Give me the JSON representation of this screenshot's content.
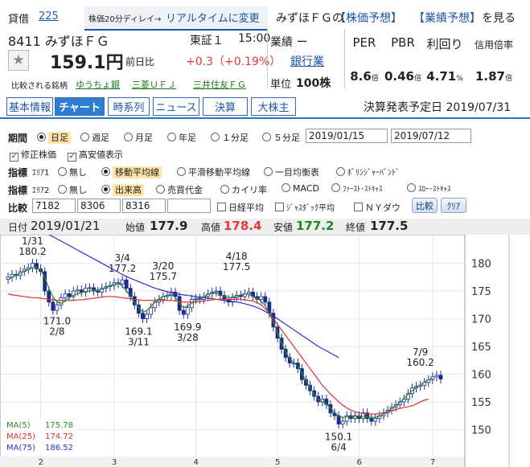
{
  "header": {
    "credit_label": "貸借",
    "market_code": "225",
    "delay_note": "株価20分ディレイ→",
    "realtime_link": "リアルタイムに変更",
    "company_q": "みずほＦＧの",
    "forecast_stock": "【株価予想】",
    "forecast_perf": "【業績予想】",
    "view_text": "を見る"
  },
  "stock": {
    "code_name": "8411 みずほＦＧ",
    "exchange": "東証１",
    "time": "15:00",
    "price": "159.1円",
    "prev_label": "前日比",
    "change": "+0.3（+0.19%）",
    "star": "★",
    "industry_label": "業績 ー",
    "industry_value": "銀行業",
    "unit_label": "単位",
    "unit_value": "100株"
  },
  "metrics": [
    {
      "label": "PER",
      "value": "8.6",
      "unit": "倍"
    },
    {
      "label": "PBR",
      "value": "0.46",
      "unit": "倍"
    },
    {
      "label": "利回り",
      "value": "4.71",
      "unit": "%"
    },
    {
      "label": "信用倍率",
      "value": "1.87",
      "unit": "倍"
    }
  ],
  "compare": {
    "label": "比較される銘柄",
    "items": [
      "ゆうちょ銀",
      "三菱ＵＦＪ",
      "三井住友ＦＧ"
    ]
  },
  "tabs": [
    "基本情報",
    "チャート",
    "時系列",
    "ニュース",
    "決算",
    "大株主"
  ],
  "earnings_text": "決算発表予定日 2019/07/31",
  "controls": {
    "period_label": "期間",
    "period_options": [
      "日足",
      "週足",
      "月足",
      "年足",
      "１分足",
      "５分足"
    ],
    "date_from": "2019/01/15",
    "date_to": "2019/07/12",
    "adj_label": "修正株価",
    "hilo_label": "高安値表示",
    "ind_label": "指標",
    "area1": "ｴﾘｱ1",
    "area1_options": [
      "無し",
      "移動平均線",
      "平滑移動平均線",
      "一目均衡表",
      "ﾎﾞﾘﾝｼﾞｬｰﾊﾞﾝﾄﾞ"
    ],
    "area2": "ｴﾘｱ2",
    "area2_options": [
      "無し",
      "出来高",
      "売買代金",
      "カイリ率",
      "MACD",
      "ﾌｧｰｽﾄ･ｽﾄｷｬｽ",
      "ｽﾛｰ･ｽﾄｷｬｽ"
    ],
    "compare_label": "比較",
    "compare_codes": [
      "7182",
      "8306",
      "8316",
      ""
    ],
    "nikkei": "日経平均",
    "jasdaq": "ｼﾞｬｽﾀﾞｯｸ平均",
    "nydow": "ＮＹダウ",
    "compare_btn": "比較",
    "clear_btn": "ｸﾘｱ"
  },
  "infobar": {
    "date_label": "日付",
    "date": "2019/01/21",
    "open_label": "始値",
    "open": "177.9",
    "high_label": "高値",
    "high": "178.4",
    "low_label": "安値",
    "low": "177.2",
    "close_label": "終値",
    "close": "177.5"
  },
  "colors": {
    "accent": "#2f7dd1",
    "up": "#e03a3a",
    "low_green": "#1d8a1d",
    "ma5": "#2a8a2a",
    "ma25": "#e03030",
    "ma75": "#3030d0"
  },
  "legend": [
    {
      "name": "MA(5)",
      "value": "175.78",
      "color": "#2a8a2a"
    },
    {
      "name": "MA(25)",
      "value": "174.72",
      "color": "#e03030"
    },
    {
      "name": "MA(75)",
      "value": "186.52",
      "color": "#3030d0"
    }
  ],
  "chart_data": {
    "type": "line",
    "ylim": [
      146,
      184
    ],
    "yticks": [
      150,
      155,
      160,
      165,
      170,
      175,
      180
    ],
    "xticks": [
      "2",
      "3",
      "4",
      "5",
      "6",
      "7"
    ],
    "annotations": [
      {
        "text": "1/31\n180.2",
        "value": 180.2
      },
      {
        "text": "171.0\n2/8",
        "value": 171.0
      },
      {
        "text": "3/4\n177.2",
        "value": 177.2
      },
      {
        "text": "169.1\n3/11",
        "value": 169.1
      },
      {
        "text": "3/20\n175.7",
        "value": 175.7
      },
      {
        "text": "169.9\n3/28",
        "value": 169.9
      },
      {
        "text": "4/18\n177.5",
        "value": 177.5
      },
      {
        "text": "150.1\n6/4",
        "value": 150.1
      },
      {
        "text": "7/9\n160.2",
        "value": 160.2
      }
    ],
    "close": [
      177.5,
      178.0,
      177.8,
      178.5,
      178.9,
      179.2,
      180.0,
      179.0,
      178.5,
      175.0,
      173.0,
      171.5,
      172.5,
      173.8,
      174.5,
      174.0,
      175.0,
      175.2,
      174.8,
      175.5,
      175.6,
      175.0,
      174.8,
      175.5,
      175.8,
      176.0,
      176.5,
      176.3,
      177.0,
      175.5,
      174.0,
      172.5,
      171.0,
      170.0,
      170.8,
      172.0,
      173.0,
      173.5,
      174.0,
      174.2,
      174.8,
      174.0,
      171.5,
      170.8,
      172.0,
      173.5,
      173.7,
      173.5,
      174.0,
      174.5,
      174.8,
      175.0,
      174.2,
      173.5,
      173.0,
      173.8,
      174.2,
      174.0,
      174.5,
      174.8,
      174.0,
      173.5,
      174.0,
      173.0,
      171.0,
      168.5,
      166.5,
      164.5,
      163.0,
      162.0,
      162.0,
      161.0,
      159.0,
      158.0,
      157.0,
      156.0,
      155.0,
      155.5,
      154.5,
      153.0,
      152.5,
      151.0,
      151.5,
      152.5,
      152.0,
      152.5,
      152.0,
      153.0,
      152.0,
      151.5,
      152.0,
      152.5,
      153.0,
      153.5,
      154.0,
      154.5,
      155.0,
      155.5,
      156.5,
      157.5,
      157.8,
      158.0,
      158.5,
      159.0,
      159.5,
      159.8,
      159.1
    ],
    "ma5": [
      177.0,
      177.5,
      177.9,
      178.2,
      178.6,
      178.9,
      179.2,
      179.3,
      178.8,
      177.5,
      175.5,
      174.0,
      173.0,
      172.8,
      173.2,
      173.8,
      174.2,
      174.5,
      174.7,
      174.9,
      175.0,
      175.1,
      175.2,
      175.3,
      175.6,
      175.9,
      176.2,
      176.4,
      175.9,
      175.0,
      174.0,
      173.0,
      172.0,
      171.2,
      171.5,
      172.2,
      173.0,
      173.6,
      174.0,
      174.2,
      174.4,
      173.8,
      172.8,
      172.0,
      172.3,
      172.8,
      173.2,
      173.6,
      174.0,
      174.4,
      174.6,
      174.6,
      174.3,
      174.0,
      173.8,
      173.9,
      174.1,
      174.3,
      174.5,
      174.4,
      174.0,
      173.6,
      173.2,
      172.3,
      171.0,
      169.4,
      167.6,
      165.6,
      164.0,
      162.7,
      162.1,
      161.4,
      160.2,
      158.8,
      157.6,
      156.4,
      155.5,
      155.0,
      154.6,
      153.9,
      153.1,
      152.4,
      152.2,
      152.3,
      152.3,
      152.4,
      152.4,
      152.4,
      152.3,
      152.2,
      152.2,
      152.4,
      152.8,
      153.3,
      153.8,
      154.3,
      154.9,
      155.6,
      156.3,
      157.0,
      157.6,
      158.1,
      158.6,
      159.0,
      159.2
    ],
    "ma25": [
      174.5,
      174.3,
      174.2,
      174.1,
      174.0,
      173.9,
      173.8,
      173.8,
      173.7,
      173.6,
      173.5,
      173.4,
      173.3,
      173.3,
      173.3,
      173.3,
      173.3,
      173.4,
      173.4,
      173.5,
      173.6,
      173.7,
      173.8,
      173.9,
      174.0,
      174.0,
      174.0,
      173.9,
      173.8,
      173.7,
      173.6,
      173.5,
      173.4,
      173.3,
      173.3,
      173.3,
      173.3,
      173.3,
      173.3,
      173.3,
      173.3,
      173.2,
      173.1,
      173.0,
      173.0,
      173.0,
      173.0,
      173.1,
      173.2,
      173.3,
      173.4,
      173.5,
      173.5,
      173.5,
      173.5,
      173.5,
      173.5,
      173.5,
      173.4,
      173.3,
      173.2,
      172.9,
      172.5,
      171.8,
      171.0,
      170.0,
      169.0,
      168.0,
      167.0,
      166.0,
      165.0,
      164.0,
      163.0,
      162.0,
      161.0,
      160.0,
      159.0,
      158.0,
      157.2,
      156.4,
      155.7,
      155.0,
      154.4,
      153.9,
      153.5,
      153.2,
      153.0,
      152.9,
      152.8,
      152.8,
      152.8,
      152.9,
      153.0,
      153.2,
      153.4,
      153.6,
      153.8,
      154.0,
      154.1,
      154.3,
      154.6,
      155.0,
      155.3,
      155.5
    ],
    "ma75": [
      188.5,
      188.2,
      187.9,
      187.6,
      187.3,
      187.0,
      186.7,
      186.4,
      186.0,
      185.6,
      185.2,
      184.8,
      184.4,
      184.0,
      183.6,
      183.2,
      182.8,
      182.4,
      182.0,
      181.6,
      181.2,
      180.8,
      180.4,
      180.0,
      179.6,
      179.2,
      178.8,
      178.4,
      178.0,
      177.6,
      177.3,
      177.0,
      176.7,
      176.4,
      176.1,
      175.8,
      175.5,
      175.3,
      175.1,
      174.9,
      174.7,
      174.5,
      174.4,
      174.3,
      174.2,
      174.1,
      174.0,
      173.9,
      173.8,
      173.7,
      173.6,
      173.5,
      173.4,
      173.3,
      173.2,
      173.1,
      173.0,
      172.9,
      172.7,
      172.5,
      172.3,
      172.0,
      171.7,
      171.3,
      170.9,
      170.5,
      170.0,
      169.5,
      169.0,
      168.5,
      168.0,
      167.5,
      167.0,
      166.5,
      166.0,
      165.5,
      165.0,
      164.6,
      164.2,
      163.8,
      163.4,
      163.0
    ]
  }
}
